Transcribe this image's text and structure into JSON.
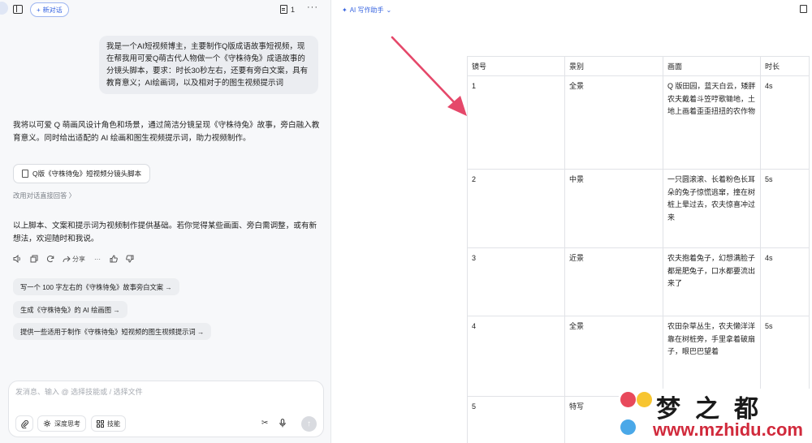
{
  "header": {
    "new_chat_label": "新对话",
    "doc_count": "1",
    "more_label": "···"
  },
  "conversation": {
    "user_message": "我是一个AI短视频博主，主要制作Q版成语故事短视频，现在帮我用可爱Q萌古代人物做一个《守株待兔》成语故事的分镜头脚本，要求：时长30秒左右，还要有旁白文案，具有教育意义；AI绘画词，以及相对于的图生视频提示词",
    "reply_intro": "我将以可爱 Q 萌画风设计角色和场景，通过简洁分镜呈现《守株待兔》故事，旁白融入教育意义。同时给出适配的 AI 绘画和图生视频提示词，助力视频制作。",
    "doc_card_title": "Q版《守株待兔》短视频分镜头脚本",
    "direct_reply_label": "改用对话直接回答 〉",
    "reply_outro": "以上脚本、文案和提示词为视频制作提供基础。若你觉得某些画面、旁白需调整，或有新想法，欢迎随时和我说。",
    "share_label": "分享",
    "suggestions": [
      "写一个 100 字左右的《守株待兔》故事旁白文案 →",
      "生成《守株待兔》的 AI 绘画图 →",
      "提供一些适用于制作《守株待兔》短视频的图生视频提示词 →"
    ]
  },
  "composer": {
    "placeholder": "发消息、输入 @ 选择技能或 / 选择文件",
    "deep_think_label": "深度思考",
    "skills_label": "技能"
  },
  "document": {
    "ai_writer_label": "AI 写作助手",
    "table": {
      "headers": [
        "镜号",
        "景别",
        "画面",
        "时长"
      ],
      "rows": [
        [
          "1",
          "全景",
          "Q 版田园，蓝天白云，矮胖农夫戴着斗笠哼歌锄地，土地上画着歪歪扭扭的农作物",
          "4s"
        ],
        [
          "2",
          "中景",
          "一只圆滚滚、长着粉色长耳朵的兔子惊慌逃窜，撞在树桩上晕过去，农夫惊喜冲过来",
          "5s"
        ],
        [
          "3",
          "近景",
          "农夫抱着兔子，幻想满脸子都是肥兔子，口水都要流出来了",
          "4s"
        ],
        [
          "4",
          "全景",
          "农田杂草丛生，农夫懒洋洋靠在树桩旁，手里拿着破扇子，眼巴巴望着",
          "5s"
        ],
        [
          "5",
          "特写",
          "",
          ""
        ]
      ]
    }
  },
  "watermark": {
    "title": "梦之都",
    "url": "www.mzhidu.com"
  },
  "colors": {
    "accent": "#2f5fe0",
    "arrow": "#e5486a",
    "watermark_url": "#d12a3c"
  }
}
